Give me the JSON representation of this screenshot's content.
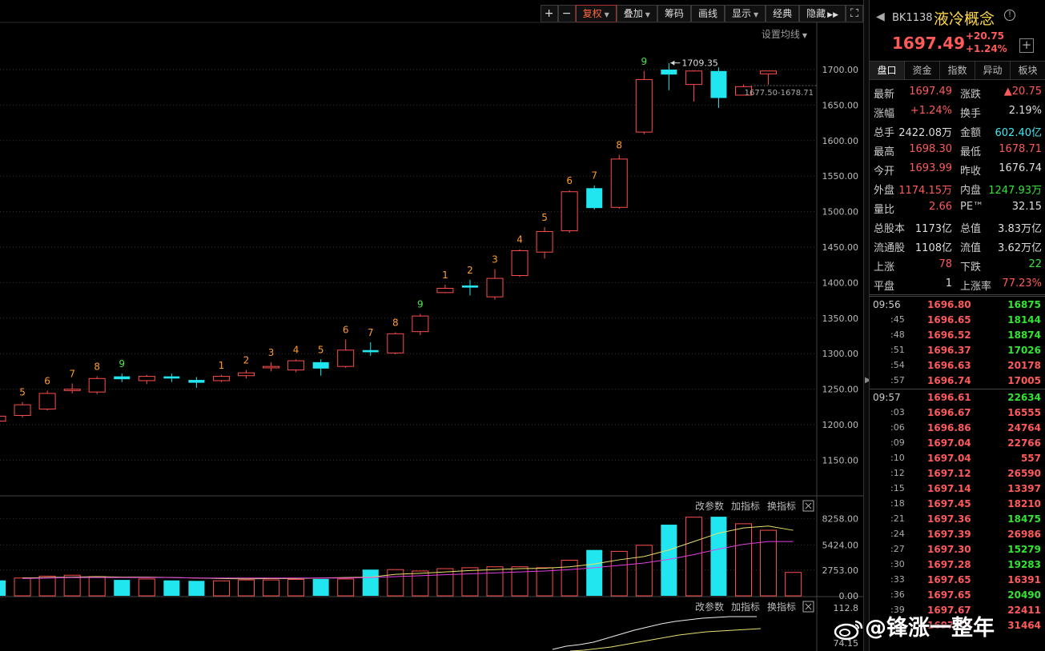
{
  "toolbar": {
    "plus": "+",
    "minus": "−",
    "fuquan": "复权",
    "diejia": "叠加",
    "chouma": "筹码",
    "huaxian": "画线",
    "xianshi": "显示",
    "jingdian": "经典",
    "yincang": "隐藏"
  },
  "ma_setting": "设置均线",
  "kline": {
    "y_labels": [
      "1700.00",
      "1650.00",
      "1600.00",
      "1550.00",
      "1500.00",
      "1450.00",
      "1400.00",
      "1350.00",
      "1300.00",
      "1250.00",
      "1200.00",
      "1150.00"
    ],
    "y_values": [
      1700,
      1650,
      1600,
      1550,
      1500,
      1450,
      1400,
      1350,
      1300,
      1250,
      1200,
      1150
    ],
    "high_label": "1709.35",
    "range_label": "1677.50-1678.71",
    "candles": [
      {
        "o": 1205,
        "c": 1212,
        "h": 1215,
        "l": 1200,
        "up": true,
        "n": ""
      },
      {
        "o": 1213,
        "c": 1228,
        "h": 1232,
        "l": 1210,
        "up": true,
        "n": "5"
      },
      {
        "o": 1222,
        "c": 1244,
        "h": 1248,
        "l": 1220,
        "up": true,
        "n": "6"
      },
      {
        "o": 1248,
        "c": 1250,
        "h": 1258,
        "l": 1244,
        "up": true,
        "n": "7"
      },
      {
        "o": 1246,
        "c": 1265,
        "h": 1268,
        "l": 1243,
        "up": true,
        "n": "8"
      },
      {
        "o": 1268,
        "c": 1264,
        "h": 1272,
        "l": 1260,
        "up": false,
        "n": "9"
      },
      {
        "o": 1262,
        "c": 1268,
        "h": 1270,
        "l": 1257,
        "up": true,
        "n": ""
      },
      {
        "o": 1268,
        "c": 1265,
        "h": 1272,
        "l": 1260,
        "up": false,
        "n": ""
      },
      {
        "o": 1263,
        "c": 1259,
        "h": 1267,
        "l": 1252,
        "up": false,
        "n": ""
      },
      {
        "o": 1262,
        "c": 1268,
        "h": 1270,
        "l": 1260,
        "up": true,
        "n": "1"
      },
      {
        "o": 1269,
        "c": 1273,
        "h": 1277,
        "l": 1265,
        "up": true,
        "n": "2"
      },
      {
        "o": 1280,
        "c": 1282,
        "h": 1288,
        "l": 1275,
        "up": true,
        "n": "3"
      },
      {
        "o": 1277,
        "c": 1290,
        "h": 1292,
        "l": 1274,
        "up": true,
        "n": "4"
      },
      {
        "o": 1288,
        "c": 1279,
        "h": 1292,
        "l": 1269,
        "up": false,
        "n": "5"
      },
      {
        "o": 1282,
        "c": 1305,
        "h": 1320,
        "l": 1280,
        "up": true,
        "n": "6"
      },
      {
        "o": 1305,
        "c": 1302,
        "h": 1316,
        "l": 1297,
        "up": false,
        "n": "7"
      },
      {
        "o": 1301,
        "c": 1328,
        "h": 1330,
        "l": 1299,
        "up": true,
        "n": "8"
      },
      {
        "o": 1331,
        "c": 1353,
        "h": 1356,
        "l": 1326,
        "up": true,
        "n": "9"
      },
      {
        "o": 1386,
        "c": 1392,
        "h": 1397,
        "l": 1385,
        "up": true,
        "n": "1"
      },
      {
        "o": 1396,
        "c": 1393,
        "h": 1404,
        "l": 1382,
        "up": false,
        "n": "2"
      },
      {
        "o": 1380,
        "c": 1406,
        "h": 1419,
        "l": 1376,
        "up": true,
        "n": "3"
      },
      {
        "o": 1410,
        "c": 1445,
        "h": 1447,
        "l": 1408,
        "up": true,
        "n": "4"
      },
      {
        "o": 1443,
        "c": 1472,
        "h": 1478,
        "l": 1434,
        "up": true,
        "n": "5"
      },
      {
        "o": 1473,
        "c": 1528,
        "h": 1530,
        "l": 1470,
        "up": true,
        "n": "6"
      },
      {
        "o": 1533,
        "c": 1505,
        "h": 1537,
        "l": 1503,
        "up": false,
        "n": "7"
      },
      {
        "o": 1506,
        "c": 1574,
        "h": 1580,
        "l": 1504,
        "up": true,
        "n": "8"
      },
      {
        "o": 1612,
        "c": 1686,
        "h": 1698,
        "l": 1609,
        "up": true,
        "n": "9"
      },
      {
        "o": 1700,
        "c": 1693,
        "h": 1709.35,
        "l": 1671,
        "up": false,
        "n": ""
      },
      {
        "o": 1679,
        "c": 1698,
        "h": 1699,
        "l": 1655,
        "up": true,
        "n": ""
      },
      {
        "o": 1698,
        "c": 1660,
        "h": 1703,
        "l": 1646,
        "up": false,
        "n": ""
      },
      {
        "o": 1664,
        "c": 1676,
        "h": 1679,
        "l": 1664,
        "up": true,
        "n": ""
      },
      {
        "o": 1694,
        "c": 1698,
        "h": 1698.3,
        "l": 1678.71,
        "up": true,
        "n": ""
      }
    ]
  },
  "volume": {
    "panel_buttons": [
      "改参数",
      "加指标",
      "换指标"
    ],
    "y_labels": [
      "8258.00",
      "5424.00",
      "2753.00",
      "0.00"
    ],
    "y_values": [
      8258,
      5424,
      2753,
      0
    ],
    "bars": [
      1650,
      1900,
      2100,
      2200,
      2050,
      1700,
      1800,
      1650,
      1600,
      1600,
      1700,
      1700,
      1750,
      1800,
      1800,
      2800,
      2800,
      2650,
      2900,
      3000,
      3100,
      3100,
      3000,
      3800,
      4900,
      4750,
      5400,
      7600,
      8400,
      8450,
      7700,
      7000,
      2500
    ],
    "bar_up": [
      false,
      true,
      true,
      true,
      true,
      false,
      true,
      false,
      false,
      true,
      true,
      true,
      true,
      false,
      true,
      false,
      true,
      true,
      true,
      true,
      true,
      true,
      true,
      true,
      false,
      true,
      true,
      false,
      true,
      false,
      true,
      true
    ],
    "ma5": [
      1900,
      1950,
      2000,
      2050,
      2000,
      2000,
      1950,
      1900,
      1850,
      1800,
      1850,
      1850,
      1900,
      1950,
      2000,
      2300,
      2400,
      2550,
      2700,
      2800,
      2900,
      2950,
      3100,
      3400,
      3850,
      4200,
      4900,
      5800,
      6700,
      7250,
      7450,
      7000
    ],
    "ma10": [
      1850,
      1900,
      1950,
      1950,
      1950,
      1950,
      1950,
      1900,
      1900,
      1900,
      1900,
      1900,
      1900,
      1900,
      1950,
      2050,
      2150,
      2250,
      2350,
      2450,
      2550,
      2650,
      2800,
      3000,
      3250,
      3500,
      3900,
      4400,
      5000,
      5500,
      5800,
      5800
    ]
  },
  "indicator": {
    "panel_buttons": [
      "改参数",
      "加指标",
      "换指标"
    ],
    "y_labels": [
      "112.8",
      "74.15"
    ]
  },
  "quote": {
    "code": "BK1138",
    "name": "液冷概念",
    "price": "1697.49",
    "change": "+20.75",
    "change_pct": "+1.24%",
    "tabs": [
      "盘口",
      "资金",
      "指数",
      "异动",
      "板块"
    ],
    "stats": [
      {
        "l1": "最新",
        "v1": "1697.49",
        "c1": "red",
        "l2": "涨跌",
        "v2": "▲20.75",
        "c2": "red"
      },
      {
        "l1": "涨幅",
        "v1": "+1.24%",
        "c1": "red",
        "l2": "换手",
        "v2": "2.19%",
        "c2": "white"
      },
      {
        "l1": "总手",
        "v1": "2422.08万",
        "c1": "white",
        "l2": "金额",
        "v2": "602.40亿",
        "c2": "cyan"
      },
      {
        "l1": "最高",
        "v1": "1698.30",
        "c1": "red",
        "l2": "最低",
        "v2": "1678.71",
        "c2": "red"
      },
      {
        "l1": "今开",
        "v1": "1693.99",
        "c1": "red",
        "l2": "昨收",
        "v2": "1676.74",
        "c2": "white"
      },
      {
        "l1": "外盘",
        "v1": "1174.15万",
        "c1": "red",
        "l2": "内盘",
        "v2": "1247.93万",
        "c2": "green"
      },
      {
        "l1": "量比",
        "v1": "2.66",
        "c1": "red",
        "l2": "PE™",
        "v2": "32.15",
        "c2": "white"
      },
      {
        "l1": "总股本",
        "v1": "1173亿",
        "c1": "white",
        "l2": "总值",
        "v2": "3.83万亿",
        "c2": "white"
      },
      {
        "l1": "流通股",
        "v1": "1108亿",
        "c1": "white",
        "l2": "流值",
        "v2": "3.62万亿",
        "c2": "white"
      },
      {
        "l1": "上涨",
        "v1": "78",
        "c1": "red",
        "l2": "下跌",
        "v2": "22",
        "c2": "green"
      },
      {
        "l1": "平盘",
        "v1": "1",
        "c1": "white",
        "l2": "上涨率",
        "v2": "77.23%",
        "c2": "red"
      }
    ],
    "ticks_a": [
      {
        "t": "09:56",
        "p": "1696.80",
        "v": "16875",
        "vc": "green",
        "main": true
      },
      {
        "t": ":45",
        "p": "1696.65",
        "v": "18144",
        "vc": "green"
      },
      {
        "t": ":48",
        "p": "1696.52",
        "v": "18874",
        "vc": "green"
      },
      {
        "t": ":51",
        "p": "1696.37",
        "v": "17026",
        "vc": "green"
      },
      {
        "t": ":54",
        "p": "1696.63",
        "v": "20178",
        "vc": "red"
      },
      {
        "t": ":57",
        "p": "1696.74",
        "v": "17005",
        "vc": "red"
      }
    ],
    "ticks_b": [
      {
        "t": "09:57",
        "p": "1696.61",
        "v": "22634",
        "vc": "green",
        "main": true
      },
      {
        "t": ":03",
        "p": "1696.67",
        "v": "16555",
        "vc": "red"
      },
      {
        "t": ":06",
        "p": "1696.86",
        "v": "24764",
        "vc": "red"
      },
      {
        "t": ":09",
        "p": "1697.04",
        "v": "22766",
        "vc": "red"
      },
      {
        "t": ":10",
        "p": "1697.04",
        "v": "557",
        "vc": "red"
      },
      {
        "t": ":12",
        "p": "1697.12",
        "v": "26590",
        "vc": "red"
      },
      {
        "t": ":15",
        "p": "1697.14",
        "v": "13397",
        "vc": "red"
      },
      {
        "t": ":18",
        "p": "1697.45",
        "v": "18210",
        "vc": "red"
      },
      {
        "t": ":21",
        "p": "1697.36",
        "v": "18475",
        "vc": "green"
      },
      {
        "t": ":24",
        "p": "1697.39",
        "v": "26986",
        "vc": "red"
      },
      {
        "t": ":27",
        "p": "1697.30",
        "v": "15279",
        "vc": "green"
      },
      {
        "t": ":30",
        "p": "1697.28",
        "v": "19283",
        "vc": "green"
      },
      {
        "t": ":33",
        "p": "1697.65",
        "v": "16391",
        "vc": "red"
      },
      {
        "t": ":36",
        "p": "1697.65",
        "v": "20490",
        "vc": "green"
      },
      {
        "t": ":39",
        "p": "1697.67",
        "v": "22411",
        "vc": "red"
      },
      {
        "t": ":42",
        "p": "1697.70",
        "v": "31464",
        "vc": "red"
      }
    ]
  },
  "watermark": "@锋涨一整年",
  "colors": {
    "up": "#ff4d4d",
    "down": "#21e6ef",
    "seq_orange": "#ff9b2e",
    "seq_green": "#4be84b",
    "grid": "#333333",
    "ma5": "#e8e070",
    "ma10": "#e040e0"
  }
}
